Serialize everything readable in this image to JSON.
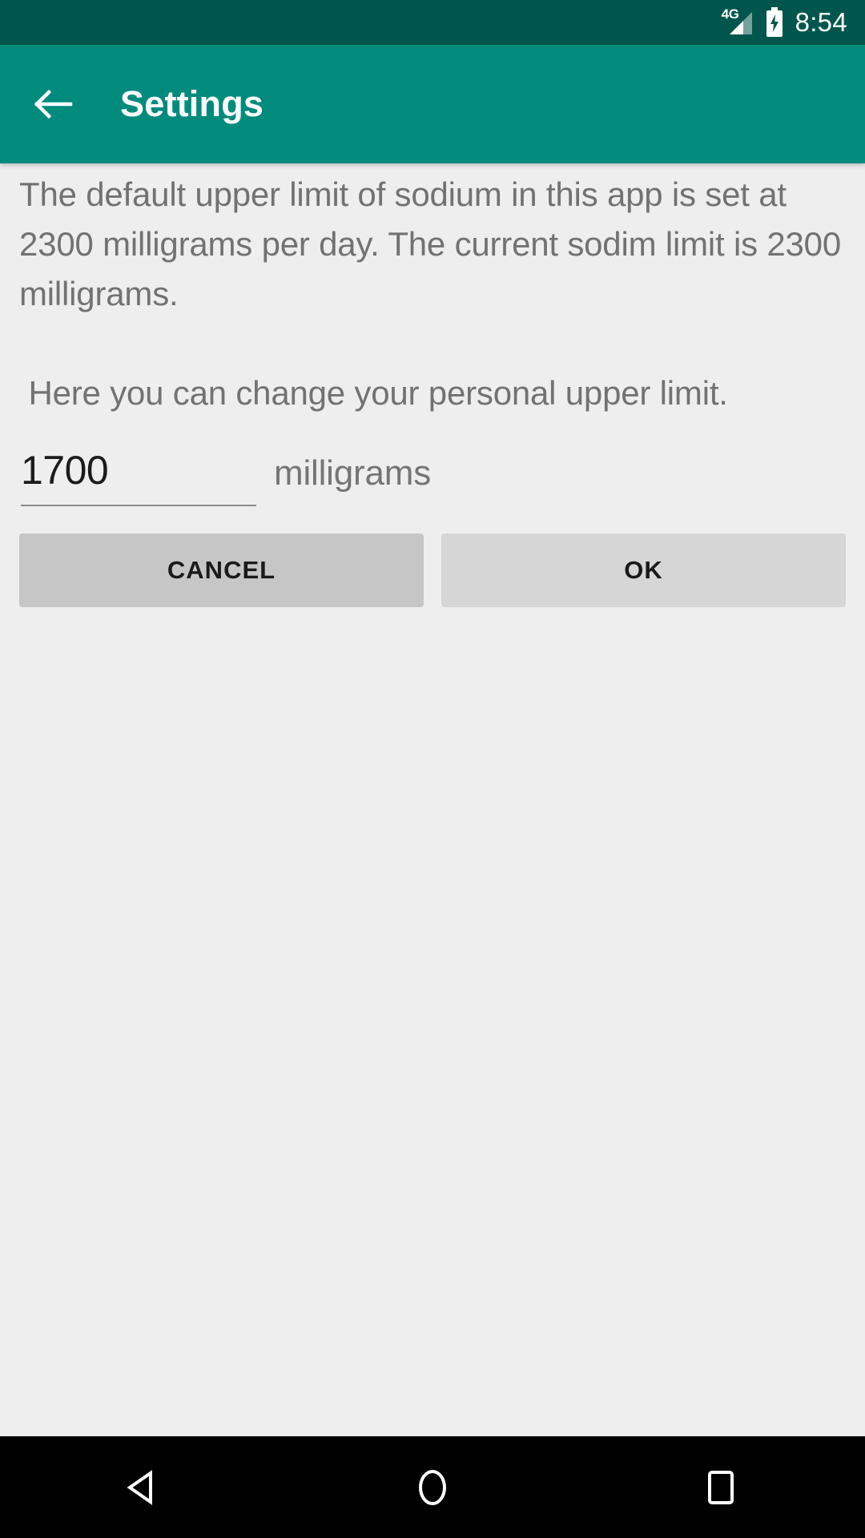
{
  "status_bar": {
    "network_label": "4G",
    "signal_icon": "signal-bars-icon",
    "battery_icon": "battery-charging-icon",
    "time": "8:54",
    "background_color": "#00564c",
    "foreground_color": "#ffffff"
  },
  "toolbar": {
    "back_icon": "back-arrow-icon",
    "title": "Settings",
    "background_color": "#008b7d",
    "title_color": "#ffffff"
  },
  "main": {
    "info_text": "The default upper limit of sodium in this app is set at 2300 milligrams per day. The current sodim limit is 2300 milligrams.\n\n Here you can change your personal upper limit.",
    "default_limit": "2300",
    "current_limit": "2300",
    "text_color": "#727272",
    "background_color": "#eeeeee",
    "limit_input": {
      "value": "1700",
      "placeholder": "",
      "unit_label": "milligrams"
    },
    "buttons": {
      "cancel_label": "CANCEL",
      "ok_label": "OK",
      "cancel_color": "#c6c6c6",
      "ok_color": "#d6d6d6"
    }
  },
  "nav_bar": {
    "back_icon": "nav-back-triangle-icon",
    "home_icon": "nav-home-circle-icon",
    "recents_icon": "nav-recents-square-icon",
    "background_color": "#000000"
  }
}
